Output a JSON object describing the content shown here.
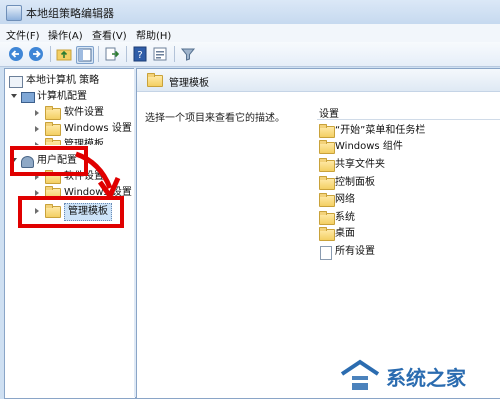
{
  "window": {
    "title": "本地组策略编辑器"
  },
  "menu": {
    "items": [
      "文件(F)",
      "操作(A)",
      "查看(V)",
      "帮助(H)"
    ]
  },
  "toolbar": {
    "icons": [
      "back-arrow-icon",
      "forward-arrow-icon",
      "up-folder-icon",
      "show-hide-tree-icon",
      "export-list-icon",
      "help-icon",
      "properties-icon",
      "filter-icon"
    ]
  },
  "tree": {
    "root": "本地计算机 策略",
    "computer_config": "计算机配置",
    "software_settings": "软件设置",
    "windows_settings": "Windows 设置",
    "admin_templates_partial": "管理模板",
    "user_config": "用户配置",
    "user_software_settings": "软件设置",
    "user_windows_settings": "Windows 设置",
    "user_admin_templates": "管理模板"
  },
  "right_pane": {
    "header": "管理模板",
    "description": "选择一个项目来查看它的描述。",
    "column_header": "设置",
    "items": [
      "“开始”菜单和任务栏",
      "Windows 组件",
      "共享文件夹",
      "控制面板",
      "网络",
      "系统",
      "桌面",
      "所有设置"
    ]
  },
  "watermark": {
    "text": "系统之家"
  },
  "colors": {
    "highlight": "#e00000",
    "folder": "#f3cf63",
    "accent": "#2b6cb0"
  }
}
